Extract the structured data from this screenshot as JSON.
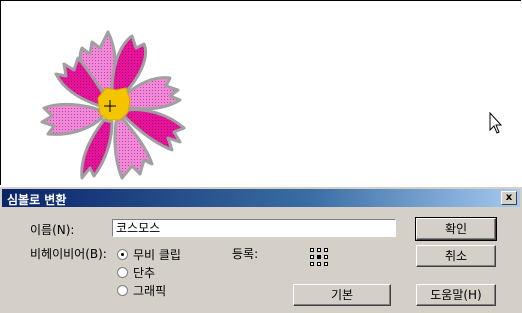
{
  "dialog": {
    "title": "심볼로 변환",
    "close_label": "x",
    "name_label": "이름(N):",
    "name_value": "코스모스",
    "behavior_label": "비헤이비어(B):",
    "behaviors": [
      {
        "label": "무비 클립",
        "checked": true
      },
      {
        "label": "단추",
        "checked": false
      },
      {
        "label": "그래픽",
        "checked": false
      }
    ],
    "registration_label": "등록:",
    "ok_label": "확인",
    "cancel_label": "취소",
    "basic_label": "기본",
    "help_label": "도움말(H)"
  },
  "colors": {
    "petal_dark": "#e5129a",
    "petal_light": "#f08ad8",
    "petal_outline": "#a0a0a0",
    "center": "#f5c400",
    "title_bar": "#0a246a",
    "dialog_bg": "#d4d0c8"
  },
  "icons": [
    "cosmos-flower-image",
    "registration-point-icon",
    "mouse-pointer-icon",
    "close-icon"
  ]
}
